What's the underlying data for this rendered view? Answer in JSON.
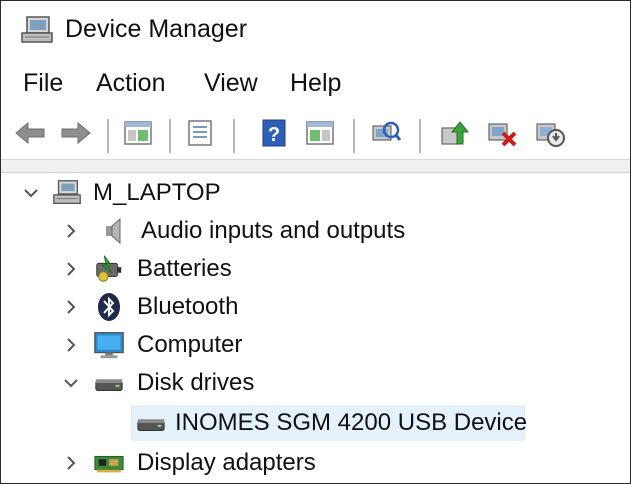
{
  "window": {
    "title": "Device Manager",
    "title_icon": "device-manager-icon"
  },
  "menu": [
    "File",
    "Action",
    "View",
    "Help"
  ],
  "toolbar": [
    {
      "name": "back-button",
      "icon": "arrow-left-icon"
    },
    {
      "name": "forward-button",
      "icon": "arrow-right-icon"
    },
    {
      "name": "show-hide-console-tree-button",
      "icon": "console-tree-icon"
    },
    {
      "name": "properties-button",
      "icon": "properties-icon"
    },
    {
      "name": "help-button",
      "icon": "help-icon"
    },
    {
      "name": "show-action-pane-button",
      "icon": "action-pane-icon"
    },
    {
      "name": "scan-hardware-button",
      "icon": "scan-hardware-icon"
    },
    {
      "name": "update-driver-button",
      "icon": "update-driver-icon"
    },
    {
      "name": "uninstall-device-button",
      "icon": "uninstall-device-icon"
    },
    {
      "name": "enable-device-button",
      "icon": "enable-device-icon"
    }
  ],
  "tree": {
    "root": {
      "label": "M_LAPTOP",
      "expanded": true,
      "icon": "computer-root-icon"
    },
    "items": [
      {
        "label": "Audio inputs and outputs",
        "icon": "speaker-icon",
        "expanded": false
      },
      {
        "label": "Batteries",
        "icon": "battery-icon",
        "expanded": false
      },
      {
        "label": "Bluetooth",
        "icon": "bluetooth-icon",
        "expanded": false
      },
      {
        "label": "Computer",
        "icon": "monitor-icon",
        "expanded": false
      },
      {
        "label": "Disk drives",
        "icon": "disk-drive-icon",
        "expanded": true,
        "children": [
          {
            "label": "INOMES SGM 4200 USB Device",
            "icon": "disk-drive-icon",
            "selected": true
          }
        ]
      },
      {
        "label": "Display adapters",
        "icon": "display-adapter-icon",
        "expanded": false
      }
    ]
  },
  "colors": {
    "selection": "#e5f1fb",
    "chevron": "#555555",
    "help_blue": "#2e5fb8",
    "uninstall_red": "#d11a1a"
  }
}
